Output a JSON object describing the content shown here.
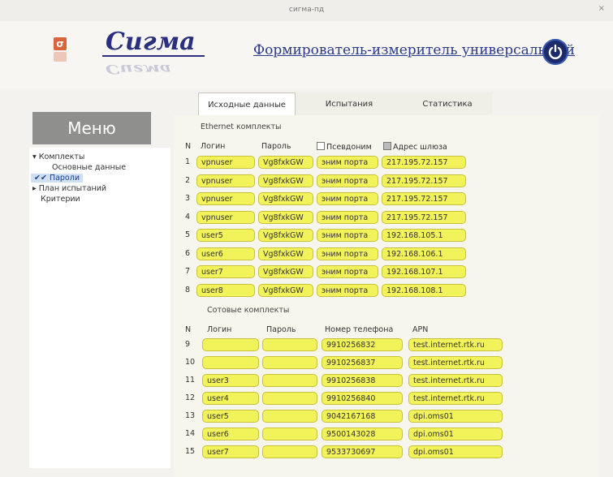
{
  "window": {
    "title": "сигма-пд",
    "close": "×"
  },
  "header": {
    "brand": "Сигма",
    "subtitle": "Формирователь-измеритель универсальный"
  },
  "menu": {
    "title": "Меню",
    "items": [
      {
        "label": "▾ Комплекты"
      },
      {
        "label": "Основные данные"
      },
      {
        "label": "✔✔ Пароли"
      },
      {
        "label": "▸ План испытаний"
      },
      {
        "label": "Критерии"
      }
    ]
  },
  "tabs": [
    {
      "label": "Исходные данные"
    },
    {
      "label": "Испытания"
    },
    {
      "label": "Статистика"
    }
  ],
  "ethernet": {
    "title": "Ethernet комплекты",
    "headers": {
      "n": "N",
      "login": "Логин",
      "password": "Пароль",
      "alias": "Псевдоним",
      "gateway": "Адрес шлюза"
    },
    "alias_checked": false,
    "gateway_checked": true,
    "rows": [
      {
        "n": "1",
        "login": "vpnuser",
        "password": "Vg8fxkGW",
        "alias": "эним порта",
        "gateway": "217.195.72.157"
      },
      {
        "n": "2",
        "login": "vpnuser",
        "password": "Vg8fxkGW",
        "alias": "эним порта",
        "gateway": "217.195.72.157"
      },
      {
        "n": "3",
        "login": "vpnuser",
        "password": "Vg8fxkGW",
        "alias": "эним порта",
        "gateway": "217.195.72.157"
      },
      {
        "n": "4",
        "login": "vpnuser",
        "password": "Vg8fxkGW",
        "alias": "эним порта",
        "gateway": "217.195.72.157"
      },
      {
        "n": "5",
        "login": "user5",
        "password": "Vg8fxkGW",
        "alias": "эним порта",
        "gateway": "192.168.105.1"
      },
      {
        "n": "6",
        "login": "user6",
        "password": "Vg8fxkGW",
        "alias": "эним порта",
        "gateway": "192.168.106.1"
      },
      {
        "n": "7",
        "login": "user7",
        "password": "Vg8fxkGW",
        "alias": "эним порта",
        "gateway": "192.168.107.1"
      },
      {
        "n": "8",
        "login": "user8",
        "password": "Vg8fxkGW",
        "alias": "эним порта",
        "gateway": "192.168.108.1"
      }
    ]
  },
  "cellular": {
    "title": "Сотовые комплекты",
    "headers": {
      "n": "N",
      "login": "Логин",
      "password": "Пароль",
      "phone": "Номер телефона",
      "apn": "APN"
    },
    "rows": [
      {
        "n": "9",
        "login": "",
        "password": "",
        "phone": "9910256832",
        "apn": "test.internet.rtk.ru"
      },
      {
        "n": "10",
        "login": "",
        "password": "",
        "phone": "9910256837",
        "apn": "test.internet.rtk.ru"
      },
      {
        "n": "11",
        "login": "user3",
        "password": "",
        "phone": "9910256838",
        "apn": "test.internet.rtk.ru"
      },
      {
        "n": "12",
        "login": "user4",
        "password": "",
        "phone": "9910256840",
        "apn": "test.internet.rtk.ru"
      },
      {
        "n": "13",
        "login": "user5",
        "password": "",
        "phone": "9042167168",
        "apn": "dpi.oms01"
      },
      {
        "n": "14",
        "login": "user6",
        "password": "",
        "phone": "9500143028",
        "apn": "dpi.oms01"
      },
      {
        "n": "15",
        "login": "user7",
        "password": "",
        "phone": "9533730697",
        "apn": "dpi.oms01"
      }
    ]
  }
}
